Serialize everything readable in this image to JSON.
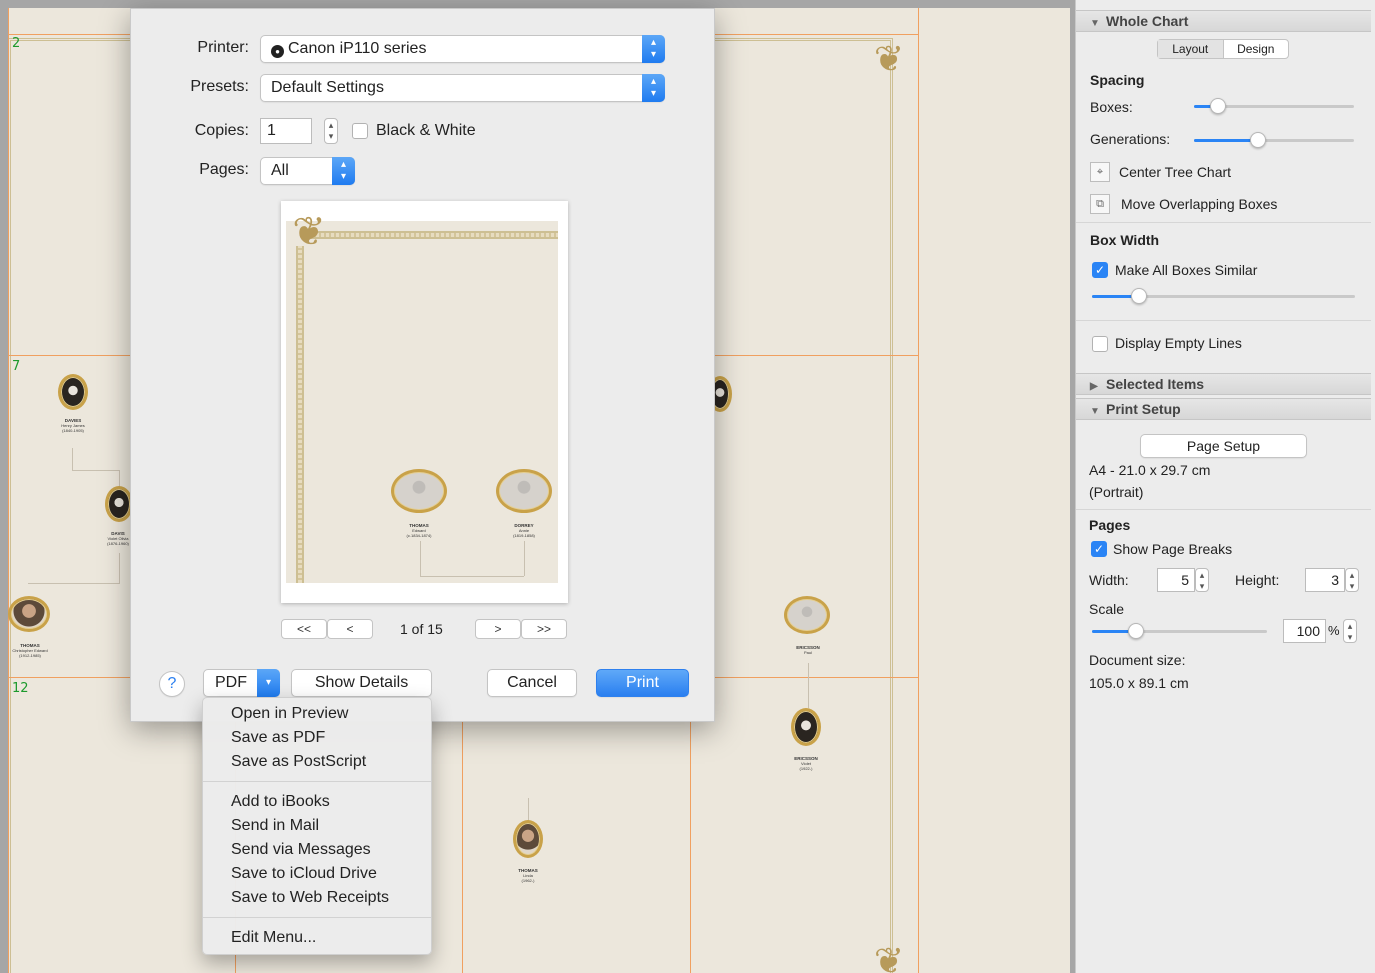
{
  "chart_canvas": {
    "page_numbers": [
      "2",
      "7",
      "12"
    ]
  },
  "print_dialog": {
    "printer_label": "Printer:",
    "printer_value": "Canon iP110 series",
    "presets_label": "Presets:",
    "presets_value": "Default Settings",
    "copies_label": "Copies:",
    "copies_value": "1",
    "bw_label": "Black & White",
    "bw_checked": false,
    "pages_label": "Pages:",
    "pages_value": "All",
    "page_indicator": "1 of 15",
    "nav_first": "<<",
    "nav_prev": "<",
    "nav_next": ">",
    "nav_last": ">>",
    "help_label": "?",
    "pdf_label": "PDF",
    "show_details_label": "Show Details",
    "cancel_label": "Cancel",
    "print_label": "Print"
  },
  "pdf_menu": {
    "group1": [
      "Open in Preview",
      "Save as PDF",
      "Save as PostScript"
    ],
    "group2": [
      "Add to iBooks",
      "Send in Mail",
      "Send via Messages",
      "Save to iCloud Drive",
      "Save to Web Receipts"
    ],
    "group3": [
      "Edit Menu..."
    ]
  },
  "inspector": {
    "whole_chart": {
      "title": "Whole Chart",
      "tabs": [
        "Layout",
        "Design"
      ],
      "spacing_title": "Spacing",
      "boxes_label": "Boxes:",
      "boxes_level": 0.15,
      "generations_label": "Generations:",
      "generations_level": 0.4,
      "center_label": "Center Tree Chart",
      "move_label": "Move Overlapping Boxes",
      "box_width_title": "Box Width",
      "similar_label": "Make All Boxes Similar",
      "similar_checked": true,
      "box_width_level": 0.18,
      "empty_lines_label": "Display Empty Lines",
      "empty_lines_checked": false
    },
    "selected_items": {
      "title": "Selected Items"
    },
    "print_setup": {
      "title": "Print Setup",
      "page_setup_label": "Page Setup",
      "paper_size": "A4 - 21.0 x 29.7 cm",
      "orientation": "(Portrait)",
      "pages_title": "Pages",
      "breaks_label": "Show Page Breaks",
      "breaks_checked": true,
      "width_label": "Width:",
      "width_value": "5",
      "height_label": "Height:",
      "height_value": "3",
      "scale_label": "Scale",
      "scale_value": "100",
      "scale_unit": "%",
      "scale_level": 0.25,
      "doc_size_label": "Document size:",
      "doc_size_value": "105.0 x 89.1 cm"
    }
  },
  "colors": {
    "accent": "#2a84f5",
    "page_break": "#f0a060",
    "page_number": "#1c9a2c",
    "chart_background": "#ece7dc"
  }
}
